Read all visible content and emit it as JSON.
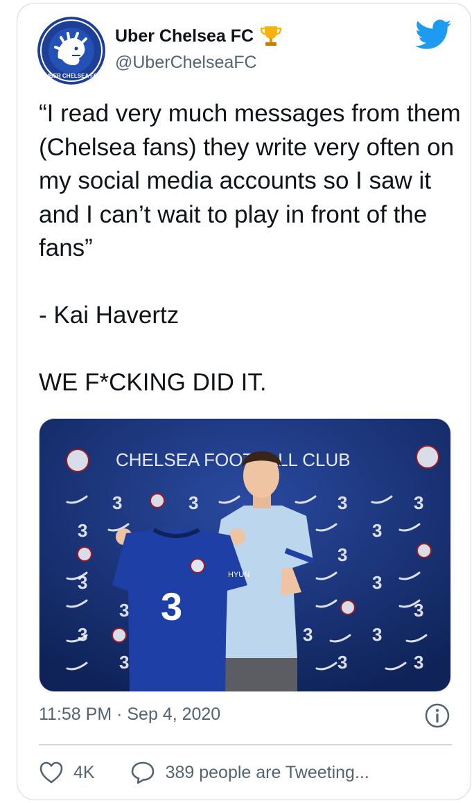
{
  "tweet": {
    "display_name": "Uber Chelsea FC",
    "handle": "@UberChelseaFC",
    "avatar_text": "UBER CHELSEA FC",
    "text": "“I read very much messages from them (Chelsea fans) they write very often on my social media accounts so I saw it and I can’t wait to play in front of the fans”\n\n- Kai Havertz\n\nWE F*CKING DID IT.",
    "time": "11:58 PM",
    "separator": " · ",
    "date": "Sep 4, 2020",
    "likes": "4K",
    "tweeting": "389 people are Tweeting..."
  },
  "media": {
    "backdrop_text": "CHELSEA FOOTBALL CLUB",
    "shirt_sponsor": "HYUN",
    "colors": {
      "backdrop": "#17306e",
      "shirt": "#1e3fa6",
      "tshirt": "#bcd6ee"
    }
  },
  "icons": {
    "brand": "twitter-bird-icon",
    "verified_emoji": "trophy-icon",
    "info": "info-icon",
    "like": "heart-icon",
    "reply": "speech-bubble-icon"
  },
  "colors": {
    "twitter_blue": "#1d9bf0",
    "text_primary": "#0f1419",
    "text_secondary": "#536471",
    "border": "#cfd9de"
  }
}
